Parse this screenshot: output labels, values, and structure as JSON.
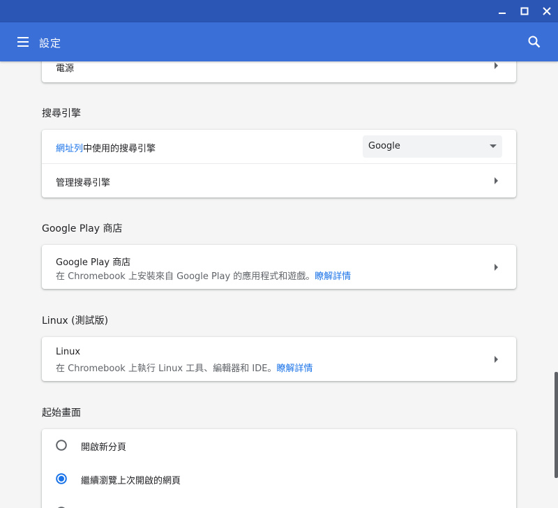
{
  "window": {
    "controls": [
      "minimize",
      "maximize",
      "close"
    ]
  },
  "toolbar": {
    "title": "設定",
    "menu_icon": "menu-icon",
    "search_icon": "search-icon"
  },
  "sections": {
    "power": {
      "item_label": "電源"
    },
    "search_engine": {
      "title": "搜尋引擎",
      "address_bar_link": "網址列",
      "address_bar_suffix": "中使用的搜尋引擎",
      "selected_engine": "Google",
      "manage_label": "管理搜尋引擎"
    },
    "google_play": {
      "title": "Google Play 商店",
      "item_label": "Google Play 商店",
      "description": "在 Chromebook 上安裝來自 Google Play 的應用程式和遊戲。",
      "learn_more": "瞭解詳情"
    },
    "linux": {
      "title": "Linux (測試版)",
      "item_label": "Linux",
      "description": "在 Chromebook 上執行 Linux 工具、編輯器和 IDE。",
      "learn_more": "瞭解詳情"
    },
    "startup": {
      "title": "起始畫面",
      "options": [
        {
          "label": "開啟新分頁",
          "selected": false
        },
        {
          "label": "繼續瀏覽上次開啟的網頁",
          "selected": true
        }
      ]
    }
  },
  "colors": {
    "titlebar": "#2b56b5",
    "toolbar": "#3a6fd8",
    "accent": "#1a73e8",
    "background": "#f5f5f5"
  }
}
